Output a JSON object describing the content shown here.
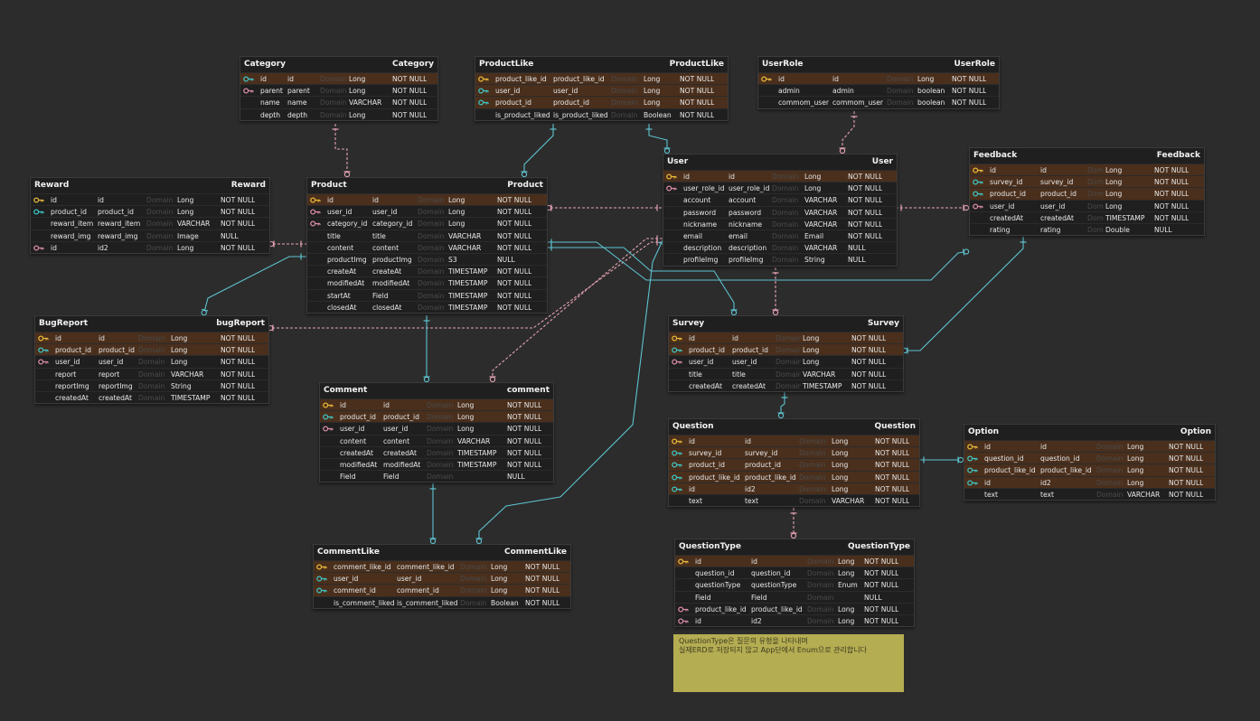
{
  "colors": {
    "canvas": "#2c2c2c",
    "entity_bg": "#1f1f1f",
    "pk_row": "#4a2f1c",
    "pk_icon": "#e8b83a",
    "fk_icon": "#d88aa8",
    "pkfk_icon": "#3ec4c4",
    "link_teal": "#5ec3d0",
    "link_pink": "#e6a3b4",
    "note_bg": "#b5ad52"
  },
  "entities": [
    {
      "id": "category",
      "name": "Category",
      "alias": "Category",
      "rows": [
        {
          "key": "pkfk",
          "col": "id",
          "phys": "id",
          "type": "Long",
          "null": "NOT NULL",
          "pk": true
        },
        {
          "key": "fk",
          "col": "parent",
          "phys": "parent",
          "type": "Long",
          "null": "NOT NULL"
        },
        {
          "key": "",
          "col": "name",
          "phys": "name",
          "type": "VARCHAR",
          "null": "NOT NULL"
        },
        {
          "key": "",
          "col": "depth",
          "phys": "depth",
          "type": "Long",
          "null": "NOT NULL"
        }
      ]
    },
    {
      "id": "productlike",
      "name": "ProductLike",
      "alias": "ProductLike",
      "rows": [
        {
          "key": "pk",
          "col": "product_like_id",
          "phys": "product_like_id",
          "type": "Long",
          "null": "NOT NULL",
          "pk": true
        },
        {
          "key": "pkfk",
          "col": "user_id",
          "phys": "user_id",
          "type": "Long",
          "null": "NOT NULL",
          "pk": true
        },
        {
          "key": "pkfk",
          "col": "product_id",
          "phys": "product_id",
          "type": "Long",
          "null": "NOT NULL",
          "pk": true
        },
        {
          "key": "",
          "col": "is_product_liked",
          "phys": "is_product_liked",
          "type": "Boolean",
          "null": "NOT NULL"
        }
      ]
    },
    {
      "id": "userrole",
      "name": "UserRole",
      "alias": "UserRole",
      "rows": [
        {
          "key": "pk",
          "col": "id",
          "phys": "id",
          "type": "Long",
          "null": "NOT NULL",
          "pk": true
        },
        {
          "key": "",
          "col": "admin",
          "phys": "admin",
          "type": "boolean",
          "null": "NOT NULL"
        },
        {
          "key": "",
          "col": "commom_user",
          "phys": "commom_user",
          "type": "boolean",
          "null": "NOT NULL"
        }
      ]
    },
    {
      "id": "reward",
      "name": "Reward",
      "alias": "Reward",
      "rows": [
        {
          "key": "pk",
          "col": "id",
          "phys": "id",
          "type": "Long",
          "null": "NOT NULL"
        },
        {
          "key": "pkfk",
          "col": "product_id",
          "phys": "product_id",
          "type": "Long",
          "null": "NOT NULL"
        },
        {
          "key": "",
          "col": "reward_item",
          "phys": "reward_item",
          "type": "VARCHAR",
          "null": "NOT NULL"
        },
        {
          "key": "",
          "col": "reward_img",
          "phys": "reward_img",
          "type": "Image",
          "null": "NULL"
        },
        {
          "key": "fk",
          "col": "id",
          "phys": "id2",
          "type": "Long",
          "null": "NOT NULL"
        }
      ]
    },
    {
      "id": "product",
      "name": "Product",
      "alias": "Product",
      "rows": [
        {
          "key": "pk",
          "col": "id",
          "phys": "id",
          "type": "Long",
          "null": "NOT NULL",
          "pk": true
        },
        {
          "key": "fk",
          "col": "user_id",
          "phys": "user_id",
          "type": "Long",
          "null": "NOT NULL"
        },
        {
          "key": "fk",
          "col": "category_id",
          "phys": "category_id",
          "type": "Long",
          "null": "NOT NULL"
        },
        {
          "key": "",
          "col": "title",
          "phys": "title",
          "type": "VARCHAR",
          "null": "NOT NULL"
        },
        {
          "key": "",
          "col": "content",
          "phys": "content",
          "type": "VARCHAR",
          "null": "NOT NULL"
        },
        {
          "key": "",
          "col": "productImg",
          "phys": "productImg",
          "type": "S3",
          "null": "NULL"
        },
        {
          "key": "",
          "col": "createAt",
          "phys": "createAt",
          "type": "TIMESTAMP",
          "null": "NOT NULL"
        },
        {
          "key": "",
          "col": "modifiedAt",
          "phys": "modifiedAt",
          "type": "TIMESTAMP",
          "null": "NOT NULL"
        },
        {
          "key": "",
          "col": "startAt",
          "phys": "Field",
          "type": "TIMESTAMP",
          "null": "NOT NULL"
        },
        {
          "key": "",
          "col": "closedAt",
          "phys": "closedAt",
          "type": "TIMESTAMP",
          "null": "NOT NULL"
        }
      ]
    },
    {
      "id": "user",
      "name": "User",
      "alias": "User",
      "rows": [
        {
          "key": "pk",
          "col": "id",
          "phys": "id",
          "type": "Long",
          "null": "NOT NULL",
          "pk": true
        },
        {
          "key": "fk",
          "col": "user_role_id",
          "phys": "user_role_id",
          "type": "Long",
          "null": "NOT NULL"
        },
        {
          "key": "",
          "col": "account",
          "phys": "account",
          "type": "VARCHAR",
          "null": "NOT NULL"
        },
        {
          "key": "",
          "col": "password",
          "phys": "password",
          "type": "VARCHAR",
          "null": "NOT NULL"
        },
        {
          "key": "",
          "col": "nickname",
          "phys": "nickname",
          "type": "VARCHAR",
          "null": "NOT NULL"
        },
        {
          "key": "",
          "col": "email",
          "phys": "email",
          "type": "Email",
          "null": "NOT NULL"
        },
        {
          "key": "",
          "col": "description",
          "phys": "description",
          "type": "VARCHAR",
          "null": "NULL"
        },
        {
          "key": "",
          "col": "profileImg",
          "phys": "profileImg",
          "type": "String",
          "null": "NULL"
        }
      ]
    },
    {
      "id": "feedback",
      "name": "Feedback",
      "alias": "Feedback",
      "rows": [
        {
          "key": "pk",
          "col": "id",
          "phys": "id",
          "type": "Long",
          "null": "NOT NULL",
          "pk": true
        },
        {
          "key": "pkfk",
          "col": "survey_id",
          "phys": "survey_id",
          "type": "Long",
          "null": "NOT NULL",
          "pk": true
        },
        {
          "key": "pkfk",
          "col": "product_id",
          "phys": "product_id",
          "type": "Long",
          "null": "NOT NULL",
          "pk": true
        },
        {
          "key": "fk",
          "col": "user_id",
          "phys": "user_id",
          "type": "Long",
          "null": "NOT NULL"
        },
        {
          "key": "",
          "col": "createdAt",
          "phys": "createdAt",
          "type": "TIMESTAMP",
          "null": "NOT NULL"
        },
        {
          "key": "",
          "col": "rating",
          "phys": "rating",
          "type": "Double",
          "null": "NULL"
        }
      ]
    },
    {
      "id": "bugreport",
      "name": "BugReport",
      "alias": "bugReport",
      "rows": [
        {
          "key": "pk",
          "col": "id",
          "phys": "id",
          "type": "Long",
          "null": "NOT NULL",
          "pk": true
        },
        {
          "key": "pkfk",
          "col": "product_id",
          "phys": "product_id",
          "type": "Long",
          "null": "NOT NULL",
          "pk": true
        },
        {
          "key": "fk",
          "col": "user_id",
          "phys": "user_id",
          "type": "Long",
          "null": "NOT NULL"
        },
        {
          "key": "",
          "col": "report",
          "phys": "report",
          "type": "VARCHAR",
          "null": "NOT NULL"
        },
        {
          "key": "",
          "col": "reportImg",
          "phys": "reportImg",
          "type": "String",
          "null": "NOT NULL"
        },
        {
          "key": "",
          "col": "createdAt",
          "phys": "createdAt",
          "type": "TIMESTAMP",
          "null": "NOT NULL"
        }
      ]
    },
    {
      "id": "comment",
      "name": "Comment",
      "alias": "comment",
      "rows": [
        {
          "key": "pk",
          "col": "id",
          "phys": "id",
          "type": "Long",
          "null": "NOT NULL",
          "pk": true
        },
        {
          "key": "pkfk",
          "col": "product_id",
          "phys": "product_id",
          "type": "Long",
          "null": "NOT NULL",
          "pk": true
        },
        {
          "key": "fk",
          "col": "user_id",
          "phys": "user_id",
          "type": "Long",
          "null": "NOT NULL"
        },
        {
          "key": "",
          "col": "content",
          "phys": "content",
          "type": "VARCHAR",
          "null": "NOT NULL"
        },
        {
          "key": "",
          "col": "createdAt",
          "phys": "createdAt",
          "type": "TIMESTAMP",
          "null": "NOT NULL"
        },
        {
          "key": "",
          "col": "modifiedAt",
          "phys": "modifiedAt",
          "type": "TIMESTAMP",
          "null": "NOT NULL"
        },
        {
          "key": "",
          "col": "Field",
          "phys": "Field",
          "type": "",
          "null": "NULL"
        }
      ]
    },
    {
      "id": "survey",
      "name": "Survey",
      "alias": "Survey",
      "rows": [
        {
          "key": "pk",
          "col": "id",
          "phys": "id",
          "type": "Long",
          "null": "NOT NULL",
          "pk": true
        },
        {
          "key": "pkfk",
          "col": "product_id",
          "phys": "product_id",
          "type": "Long",
          "null": "NOT NULL",
          "pk": true
        },
        {
          "key": "fk",
          "col": "user_id",
          "phys": "user_id",
          "type": "Long",
          "null": "NOT NULL"
        },
        {
          "key": "",
          "col": "title",
          "phys": "title",
          "type": "VARCHAR",
          "null": "NOT NULL"
        },
        {
          "key": "",
          "col": "createdAt",
          "phys": "createdAt",
          "type": "TIMESTAMP",
          "null": "NOT NULL"
        }
      ]
    },
    {
      "id": "question",
      "name": "Question",
      "alias": "Question",
      "rows": [
        {
          "key": "pk",
          "col": "id",
          "phys": "id",
          "type": "Long",
          "null": "NOT NULL",
          "pk": true
        },
        {
          "key": "pkfk",
          "col": "survey_id",
          "phys": "survey_id",
          "type": "Long",
          "null": "NOT NULL",
          "pk": true
        },
        {
          "key": "pkfk",
          "col": "product_id",
          "phys": "product_id",
          "type": "Long",
          "null": "NOT NULL",
          "pk": true
        },
        {
          "key": "pkfk",
          "col": "product_like_id",
          "phys": "product_like_id",
          "type": "Long",
          "null": "NOT NULL",
          "pk": true
        },
        {
          "key": "pkfk",
          "col": "id",
          "phys": "id2",
          "type": "Long",
          "null": "NOT NULL",
          "pk": true
        },
        {
          "key": "",
          "col": "text",
          "phys": "text",
          "type": "VARCHAR",
          "null": "NOT NULL"
        }
      ]
    },
    {
      "id": "option",
      "name": "Option",
      "alias": "Option",
      "rows": [
        {
          "key": "pk",
          "col": "id",
          "phys": "id",
          "type": "Long",
          "null": "NOT NULL",
          "pk": true
        },
        {
          "key": "pkfk",
          "col": "question_id",
          "phys": "question_id",
          "type": "Long",
          "null": "NOT NULL",
          "pk": true
        },
        {
          "key": "pkfk",
          "col": "product_like_id",
          "phys": "product_like_id",
          "type": "Long",
          "null": "NOT NULL",
          "pk": true
        },
        {
          "key": "pkfk",
          "col": "id",
          "phys": "id2",
          "type": "Long",
          "null": "NOT NULL",
          "pk": true
        },
        {
          "key": "",
          "col": "text",
          "phys": "text",
          "type": "VARCHAR",
          "null": "NOT NULL"
        }
      ]
    },
    {
      "id": "commentlike",
      "name": "CommentLike",
      "alias": "CommentLike",
      "rows": [
        {
          "key": "pk",
          "col": "comment_like_id",
          "phys": "comment_like_id",
          "type": "Long",
          "null": "NOT NULL",
          "pk": true
        },
        {
          "key": "pkfk",
          "col": "user_id",
          "phys": "user_id",
          "type": "Long",
          "null": "NOT NULL",
          "pk": true
        },
        {
          "key": "pkfk",
          "col": "comment_id",
          "phys": "comment_id",
          "type": "Long",
          "null": "NOT NULL",
          "pk": true
        },
        {
          "key": "",
          "col": "is_comment_liked",
          "phys": "is_comment_liked",
          "type": "Boolean",
          "null": "NOT NULL"
        }
      ]
    },
    {
      "id": "questiontype",
      "name": "QuestionType",
      "alias": "QuestionType",
      "rows": [
        {
          "key": "pk",
          "col": "id",
          "phys": "id",
          "type": "Long",
          "null": "NOT NULL",
          "pk": true
        },
        {
          "key": "",
          "col": "question_id",
          "phys": "question_id",
          "type": "Long",
          "null": "NOT NULL"
        },
        {
          "key": "",
          "col": "questionType",
          "phys": "questionType",
          "type": "Enum",
          "null": "NOT NULL"
        },
        {
          "key": "",
          "col": "Field",
          "phys": "Field",
          "type": "",
          "null": "NULL"
        },
        {
          "key": "fk",
          "col": "product_like_id",
          "phys": "product_like_id",
          "type": "Long",
          "null": "NOT NULL"
        },
        {
          "key": "fk",
          "col": "id",
          "phys": "id2",
          "type": "Long",
          "null": "NOT NULL"
        }
      ]
    }
  ],
  "note": {
    "line1": "QuestionType은 질문의 유형을 나타내며",
    "line2": "실제ERD로 저장되지 않고 App단에서 Enum으로 관리합니다"
  }
}
